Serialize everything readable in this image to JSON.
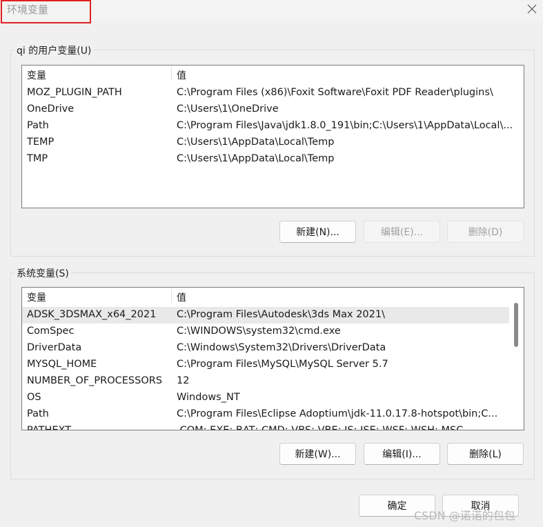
{
  "window": {
    "title": "环境变量",
    "close_icon": "close-icon"
  },
  "user_vars": {
    "group_label": "qi 的用户变量(U)",
    "columns": [
      "变量",
      "值"
    ],
    "rows": [
      {
        "name": "MOZ_PLUGIN_PATH",
        "value": "C:\\Program Files (x86)\\Foxit Software\\Foxit PDF Reader\\plugins\\"
      },
      {
        "name": "OneDrive",
        "value": "C:\\Users\\1\\OneDrive"
      },
      {
        "name": "Path",
        "value": "C:\\Program Files\\Java\\jdk1.8.0_191\\bin;C:\\Users\\1\\AppData\\Local\\..."
      },
      {
        "name": "TEMP",
        "value": "C:\\Users\\1\\AppData\\Local\\Temp"
      },
      {
        "name": "TMP",
        "value": "C:\\Users\\1\\AppData\\Local\\Temp"
      }
    ],
    "buttons": {
      "new": "新建(N)...",
      "edit": "编辑(E)...",
      "delete": "删除(D)"
    }
  },
  "system_vars": {
    "group_label": "系统变量(S)",
    "columns": [
      "变量",
      "值"
    ],
    "rows": [
      {
        "name": "ADSK_3DSMAX_x64_2021",
        "value": "C:\\Program Files\\Autodesk\\3ds Max 2021\\"
      },
      {
        "name": "ComSpec",
        "value": "C:\\WINDOWS\\system32\\cmd.exe"
      },
      {
        "name": "DriverData",
        "value": "C:\\Windows\\System32\\Drivers\\DriverData"
      },
      {
        "name": "MYSQL_HOME",
        "value": "C:\\Program Files\\MySQL\\MySQL Server 5.7"
      },
      {
        "name": "NUMBER_OF_PROCESSORS",
        "value": "12"
      },
      {
        "name": "OS",
        "value": "Windows_NT"
      },
      {
        "name": "Path",
        "value": "C:\\Program Files\\Eclipse Adoptium\\jdk-11.0.17.8-hotspot\\bin;C..."
      },
      {
        "name": "PATHEXT",
        "value": ".COM;.EXE;.BAT;.CMD;.VBS;.VBE;.JS;.JSE;.WSF;.WSH;.MSC"
      }
    ],
    "buttons": {
      "new": "新建(W)...",
      "edit": "编辑(I)...",
      "delete": "删除(L)"
    }
  },
  "footer": {
    "ok": "确定",
    "cancel": "取消"
  },
  "watermark": "CSDN @诺诺的包包",
  "colors": {
    "highlight_box": "#e02020",
    "selected_row": "#e9e9e9"
  }
}
